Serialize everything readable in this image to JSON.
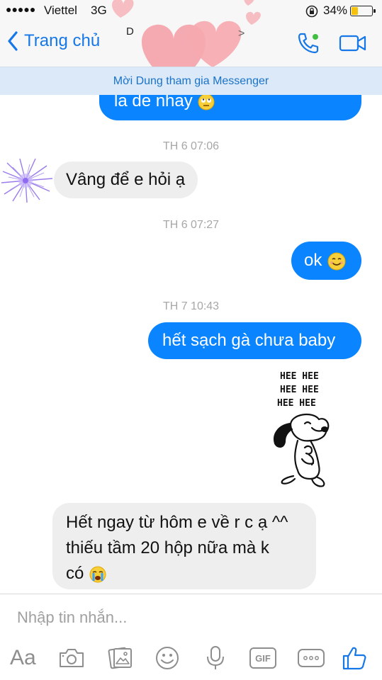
{
  "status_bar": {
    "signal": "●●●●●",
    "carrier": "Viettel",
    "network": "3G",
    "battery_percent": "34%",
    "battery_level": 0.34
  },
  "nav": {
    "back_label": "Trang chủ",
    "contact_initial": "D"
  },
  "banner": {
    "text": "Mời Dung tham gia Messenger"
  },
  "messages": {
    "m1": "la de nhay",
    "ts1": "TH 6 07:06",
    "m2": "Vâng để e hỏi ạ",
    "ts2": "TH 6 07:27",
    "m3": "ok",
    "ts3": "TH 7 10:43",
    "m4": "hết sạch gà chưa baby",
    "sticker_text": [
      "HEE HEE",
      "HEE HEE",
      "HEE HEE"
    ],
    "m5_line1": "Hết ngay từ hôm e về r c ạ ^^",
    "m5_line2": "thiếu tầm 20 hộp nữa mà k",
    "m5_line3": "có"
  },
  "composer": {
    "placeholder": "Nhập tin nhắn...",
    "aa_label": "Aa",
    "gif_label": "GIF"
  },
  "colors": {
    "accent": "#0a84ff",
    "incoming": "#eeeeee",
    "banner_bg": "#dbe9f9",
    "banner_text": "#1a73c8"
  }
}
